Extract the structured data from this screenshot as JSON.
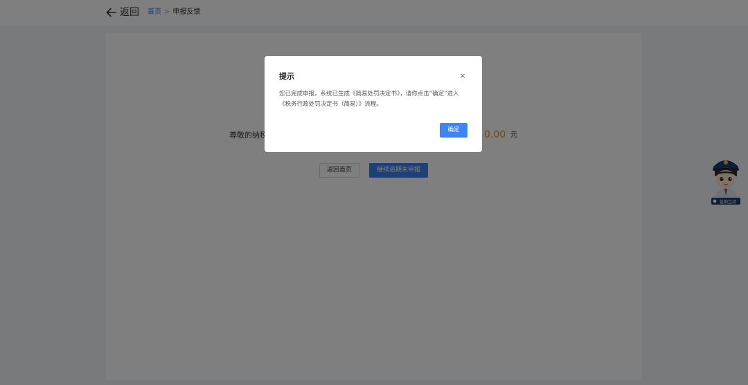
{
  "header": {
    "back_label": "返回",
    "breadcrumb": {
      "home": "首页",
      "separator": ">",
      "current": "申报反馈"
    }
  },
  "content": {
    "notice_prefix": "尊敬的纳税",
    "amount": "0.00",
    "unit": "元",
    "buttons": {
      "home": "返回首页",
      "continue": "继续逾期未申报"
    }
  },
  "dialog": {
    "title": "提示",
    "close_symbol": "×",
    "message": "您已完成申报，系统已生成《简易处罚决定书》，请你点击“确定”进入《税务行政处罚决定书（简易）》流程。",
    "ok_label": "确定"
  },
  "mascot": {
    "badge_text": "征纳互动"
  },
  "colors": {
    "accent": "#3f7ef0",
    "link": "#3e7bd9",
    "amount": "#e0900b",
    "overlay": "rgba(0,0,0,0.5)"
  },
  "icons": {
    "back": "arrow-left-icon",
    "close": "close-icon",
    "mascot": "assistant-mascot-icon"
  }
}
